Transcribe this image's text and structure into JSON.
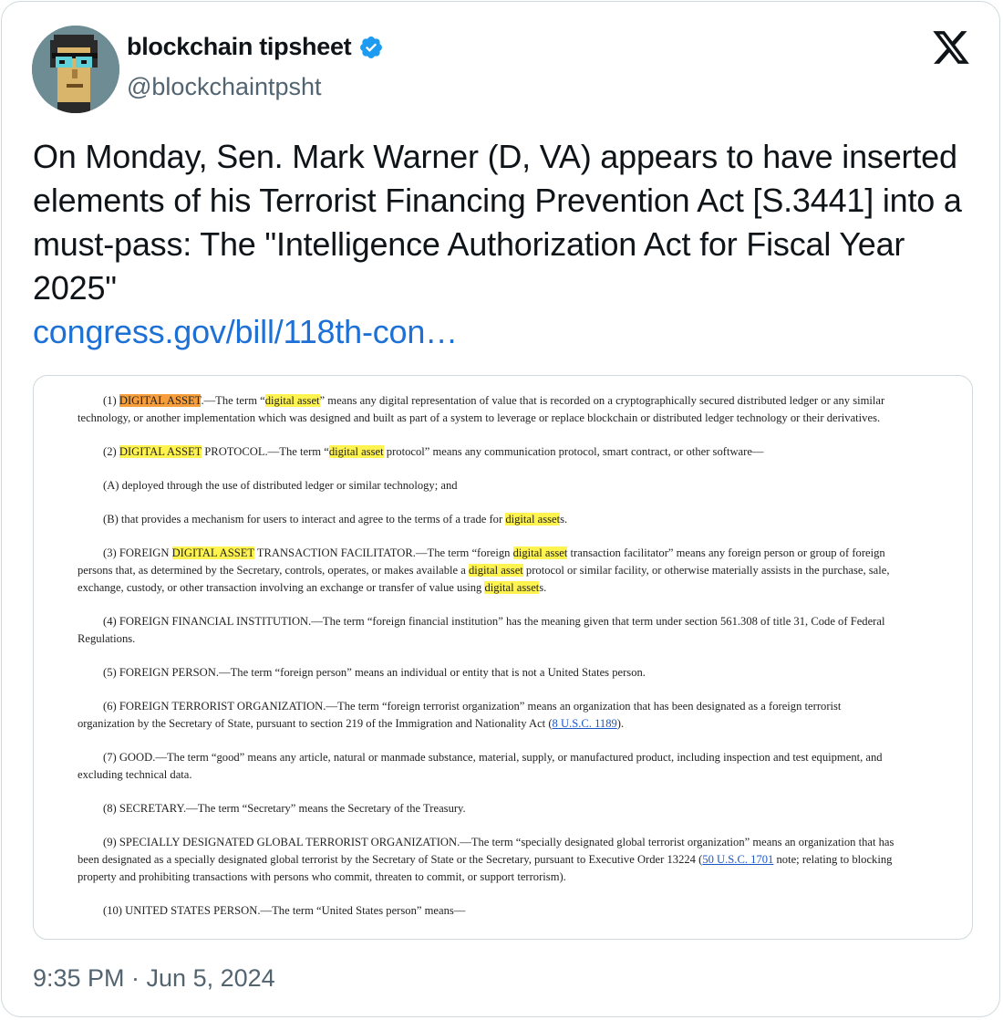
{
  "author": {
    "name": "blockchain tipsheet",
    "handle": "@blockchaintpsht",
    "verified": true,
    "verified_color": "#1d9bf0"
  },
  "tweet": {
    "text": "On Monday, Sen. Mark Warner (D, VA) appears to have inserted elements of his Terrorist Financing Prevention Act [S.3441] into a must-pass: The \"Intelligence Authorization Act for Fiscal Year 2025\"",
    "link": "congress.gov/bill/118th-con…",
    "timestamp": "9:35 PM · Jun 5, 2024"
  },
  "document": {
    "p1_a": "(1) ",
    "p1_term": "DIGITAL ASSET",
    "p1_b": ".—The term “",
    "p1_hl": "digital asset",
    "p1_c": "” means any digital representation of value that is recorded on a cryptographically secured distributed ledger or any similar technology, or another implementation which was designed and built as part of a system to leverage or replace blockchain or distributed ledger technology or their derivatives.",
    "p2_a": "(2) ",
    "p2_term": "DIGITAL ASSET",
    "p2_b": " PROTOCOL.—The term “",
    "p2_hl": "digital asset",
    "p2_c": " protocol” means any communication protocol, smart contract, or other software—",
    "pA": "(A) deployed through the use of distributed ledger or similar technology; and",
    "pB_a": "(B) that provides a mechanism for users to interact and agree to the terms of a trade for ",
    "pB_hl": "digital asset",
    "pB_b": "s.",
    "p3_a": "(3) FOREIGN ",
    "p3_term": "DIGITAL ASSET",
    "p3_b": " TRANSACTION FACILITATOR.—The term “foreign ",
    "p3_hl1": "digital asset",
    "p3_c": " transaction facilitator” means any foreign person or group of foreign persons that, as determined by the Secretary, controls, operates, or makes available a ",
    "p3_hl2": "digital asset",
    "p3_d": " protocol or similar facility, or otherwise materially assists in the purchase, sale, exchange, custody, or other transaction involving an exchange or transfer of value using ",
    "p3_hl3": "digital asset",
    "p3_e": "s.",
    "p4": "(4) FOREIGN FINANCIAL INSTITUTION.—The term “foreign financial institution” has the meaning given that term under section 561.308 of title 31, Code of Federal Regulations.",
    "p5": "(5) FOREIGN PERSON.—The term “foreign person” means an individual or entity that is not a United States person.",
    "p6_a": "(6) FOREIGN TERRORIST ORGANIZATION.—The term “foreign terrorist organization” means an organization that has been designated as a foreign terrorist organization by the Secretary of State, pursuant to section 219 of the Immigration and Nationality Act (",
    "p6_link": "8 U.S.C. 1189",
    "p6_b": ").",
    "p7": "(7) GOOD.—The term “good” means any article, natural or manmade substance, material, supply, or manufactured product, including inspection and test equipment, and excluding technical data.",
    "p8": "(8) SECRETARY.—The term “Secretary” means the Secretary of the Treasury.",
    "p9_a": "(9) SPECIALLY DESIGNATED GLOBAL TERRORIST ORGANIZATION.—The term “specially designated global terrorist organization” means an organization that has been designated as a specially designated global terrorist by the Secretary of State or the Secretary, pursuant to Executive Order 13224 (",
    "p9_link": "50 U.S.C. 1701",
    "p9_b": " note; relating to blocking property and prohibiting transactions with persons who commit, threaten to commit, or support terrorism).",
    "p10": "(10) UNITED STATES PERSON.—The term “United States person” means—"
  },
  "icons": {
    "brand": "x-logo-icon",
    "verified": "verified-badge-icon"
  }
}
